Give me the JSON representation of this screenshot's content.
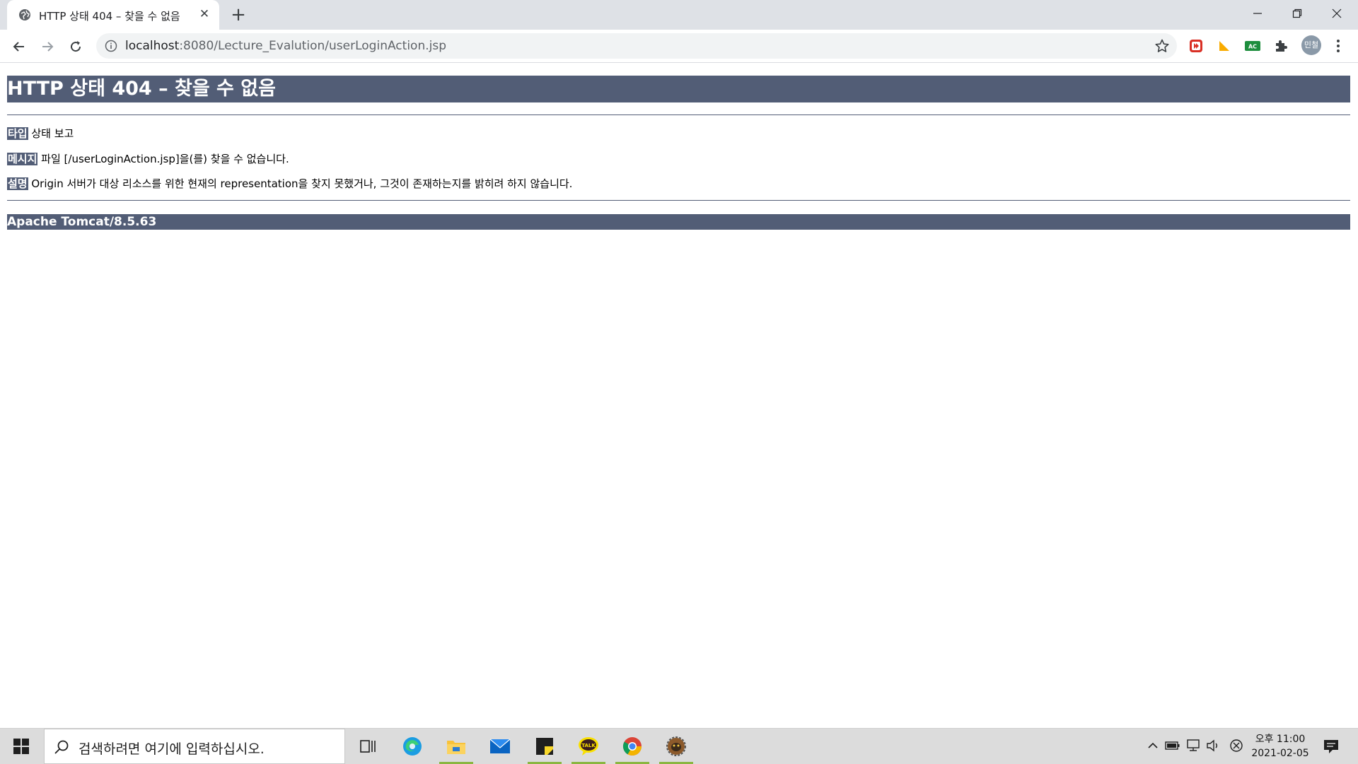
{
  "browser": {
    "tab_title": "HTTP 상태 404 – 찾을 수 없음",
    "close_tab_glyph": "✕",
    "new_tab_glyph": "+",
    "url_host": "localhost",
    "url_path": ":8080/Lecture_Evalution/userLoginAction.jsp",
    "profile_label": "민철",
    "extension_badge": "AC"
  },
  "page": {
    "heading": "HTTP 상태 404 – 찾을 수 없음",
    "rows": [
      {
        "label": "타입",
        "text": " 상태 보고"
      },
      {
        "label": "메시지",
        "text": " 파일 [/userLoginAction.jsp]을(를) 찾을 수 없습니다."
      },
      {
        "label": "설명",
        "text": " Origin 서버가 대상 리소스를 위한 현재의 representation을 찾지 못했거나, 그것이 존재하는지를 밝히려 하지 않습니다."
      }
    ],
    "footer": "Apache Tomcat/8.5.63"
  },
  "taskbar": {
    "search_placeholder": "검색하려면 여기에 입력하십시오.",
    "time": "오후 11:00",
    "date": "2021-02-05",
    "apps": [
      "task-view",
      "edge",
      "file-explorer",
      "mail",
      "sticky-notes",
      "kakaotalk",
      "chrome",
      "tomcat"
    ]
  },
  "colors": {
    "tomcat_header": "#525d76",
    "tab_bar": "#dee1e6",
    "omnibox": "#f1f3f4",
    "taskbar": "#dcdcdc"
  }
}
